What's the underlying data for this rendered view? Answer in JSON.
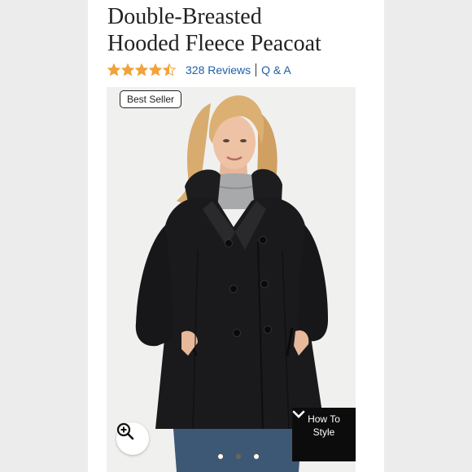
{
  "product": {
    "title_line1": "Double-Breasted",
    "title_line2": "Hooded Fleece Peacoat",
    "rating": 4.5,
    "max_rating": 5,
    "reviews_label": "328 Reviews",
    "qa_label": "Q & A"
  },
  "gallery": {
    "badge": "Best Seller",
    "how_to_line1": "How To",
    "how_to_line2": "Style",
    "image_count": 3,
    "active_index": 1,
    "icons": {
      "zoom": "zoom-in-icon",
      "chevron": "chevron-down-icon"
    }
  },
  "colors": {
    "star": "#f0a33c",
    "link": "#1f5fa8",
    "coat": "#1a1a1c",
    "turtleneck": "#a7a9ab",
    "hair": "#d8ac6f",
    "jeans": "#3d5875"
  }
}
